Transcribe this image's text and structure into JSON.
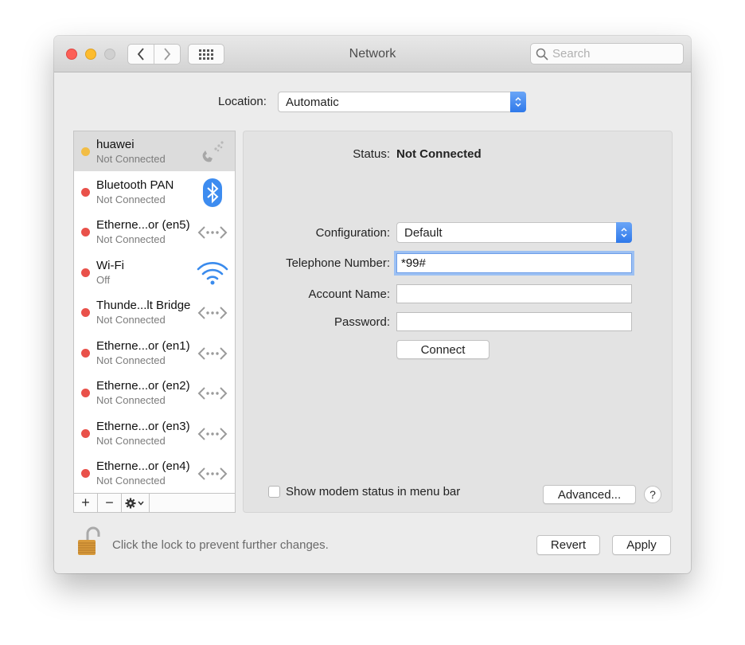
{
  "window": {
    "title": "Network",
    "search_placeholder": "Search"
  },
  "location": {
    "label": "Location:",
    "value": "Automatic"
  },
  "services": [
    {
      "name": "huawei",
      "status": "Not Connected",
      "dot_color": "#f2bd45",
      "icon": "phone-modem-icon",
      "selected": true
    },
    {
      "name": "Bluetooth PAN",
      "status": "Not Connected",
      "dot_color": "#e9514a",
      "icon": "bluetooth-icon",
      "selected": false
    },
    {
      "name": "Etherne...or (en5)",
      "status": "Not Connected",
      "dot_color": "#e9514a",
      "icon": "ethernet-icon",
      "selected": false
    },
    {
      "name": "Wi-Fi",
      "status": "Off",
      "dot_color": "#e9514a",
      "icon": "wifi-icon",
      "selected": false
    },
    {
      "name": "Thunde...lt Bridge",
      "status": "Not Connected",
      "dot_color": "#e9514a",
      "icon": "ethernet-icon",
      "selected": false
    },
    {
      "name": "Etherne...or (en1)",
      "status": "Not Connected",
      "dot_color": "#e9514a",
      "icon": "ethernet-icon",
      "selected": false
    },
    {
      "name": "Etherne...or (en2)",
      "status": "Not Connected",
      "dot_color": "#e9514a",
      "icon": "ethernet-icon",
      "selected": false
    },
    {
      "name": "Etherne...or (en3)",
      "status": "Not Connected",
      "dot_color": "#e9514a",
      "icon": "ethernet-icon",
      "selected": false
    },
    {
      "name": "Etherne...or (en4)",
      "status": "Not Connected",
      "dot_color": "#e9514a",
      "icon": "ethernet-icon",
      "selected": false
    }
  ],
  "sidebar_controls": {
    "add": "+",
    "remove": "−"
  },
  "detail": {
    "status_label": "Status:",
    "status_value": "Not Connected",
    "configuration_label": "Configuration:",
    "configuration_value": "Default",
    "telephone_label": "Telephone Number:",
    "telephone_value": "*99#",
    "account_label": "Account Name:",
    "account_value": "",
    "password_label": "Password:",
    "password_value": "",
    "connect_button": "Connect",
    "show_modem_label": "Show modem status in menu bar",
    "show_modem_checked": false,
    "advanced_button": "Advanced...",
    "help_button": "?"
  },
  "footer": {
    "lock_text": "Click the lock to prevent further changes.",
    "revert_button": "Revert",
    "apply_button": "Apply"
  },
  "colors": {
    "accent": "#2f79ea",
    "status_red": "#e9514a",
    "status_yellow": "#f2bd45"
  }
}
